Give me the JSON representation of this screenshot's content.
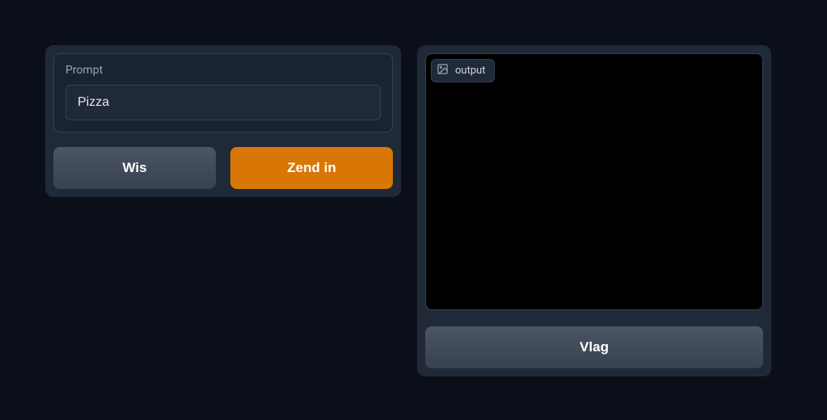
{
  "left": {
    "prompt_label": "Prompt",
    "prompt_value": "Pizza",
    "clear_label": "Wis",
    "submit_label": "Zend in"
  },
  "right": {
    "output_tag": "output",
    "flag_label": "Vlag"
  }
}
